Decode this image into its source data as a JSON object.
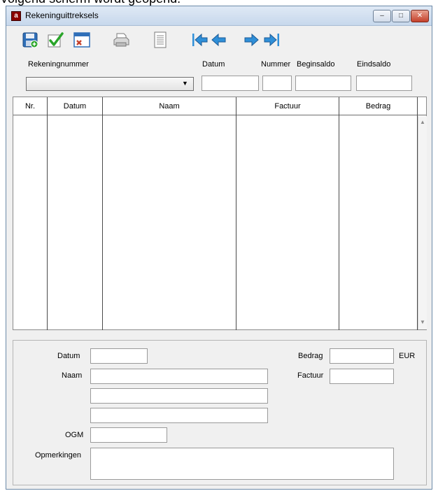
{
  "caption": "Volgend scherm wordt geopend:",
  "window": {
    "title": "Rekeninguittreksels",
    "title_icon": "a",
    "controls": {
      "minimize": "–",
      "maximize": "□",
      "close": "✕"
    }
  },
  "toolbar": {
    "icons": [
      "save-icon",
      "confirm-icon",
      "cancel-window-icon",
      "print-icon",
      "document-icon",
      "first-record-icon",
      "previous-record-icon",
      "next-record-icon",
      "last-record-icon"
    ]
  },
  "header_fields": {
    "rekeningnummer_label": "Rekeningnummer",
    "datum_label": "Datum",
    "nummer_label": "Nummer",
    "beginsaldo_label": "Beginsaldo",
    "eindsaldo_label": "Eindsaldo",
    "rekeningnummer_value": "",
    "datum_value": "",
    "nummer_value": "",
    "beginsaldo_value": "",
    "eindsaldo_value": ""
  },
  "grid": {
    "columns": [
      "Nr.",
      "Datum",
      "Naam",
      "Factuur",
      "Bedrag"
    ],
    "rows": []
  },
  "detail": {
    "datum_label": "Datum",
    "naam_label": "Naam",
    "ogm_label": "OGM",
    "opmerkingen_label": "Opmerkingen",
    "bedrag_label": "Bedrag",
    "factuur_label": "Factuur",
    "currency": "EUR",
    "datum_value": "",
    "naam_values": [
      "",
      "",
      ""
    ],
    "ogm_value": "",
    "opmerkingen_value": "",
    "bedrag_value": "",
    "factuur_value": ""
  },
  "colors": {
    "title_gradient_top": "#dfe9f5",
    "arrow_blue": "#2f8fd8",
    "check_green": "#2aa52a",
    "close_red": "#c4402a"
  }
}
